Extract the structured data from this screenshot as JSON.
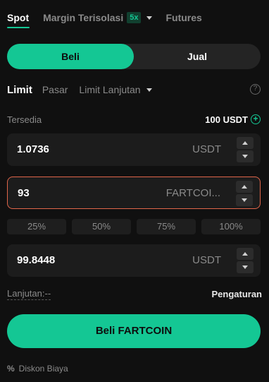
{
  "market_tabs": {
    "spot": "Spot",
    "margin": "Margin Terisolasi",
    "leverage": "5x",
    "futures": "Futures"
  },
  "side_toggle": {
    "buy": "Beli",
    "sell": "Jual"
  },
  "order_types": {
    "limit": "Limit",
    "market": "Pasar",
    "advanced": "Limit Lanjutan",
    "help_icon": "?"
  },
  "available": {
    "label": "Tersedia",
    "value": "100 USDT",
    "add_icon": "+"
  },
  "price_field": {
    "value": "1.0736",
    "unit": "USDT"
  },
  "amount_field": {
    "value": "93",
    "unit": "FARTCOI..."
  },
  "percent_options": [
    "25%",
    "50%",
    "75%",
    "100%"
  ],
  "total_field": {
    "value": "99.8448",
    "unit": "USDT"
  },
  "advanced": {
    "label": "Lanjutan:--",
    "settings": "Pengaturan"
  },
  "submit_label": "Beli FARTCOIN",
  "fee": {
    "icon": "%",
    "label": "Diskon Biaya"
  },
  "colors": {
    "accent": "#14c794",
    "background": "#101010",
    "field_bg": "#1c1c1c",
    "focus_border": "#e0664a"
  }
}
